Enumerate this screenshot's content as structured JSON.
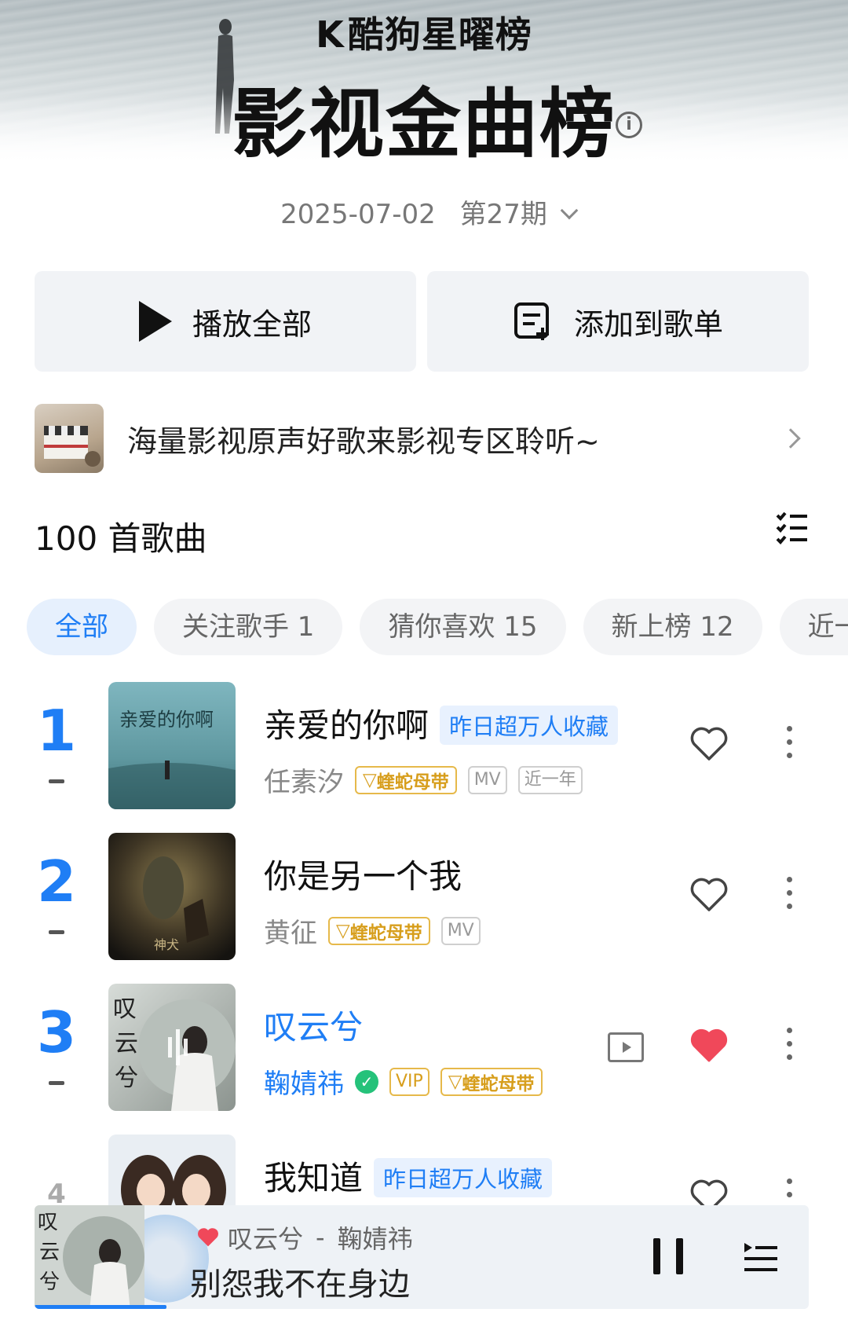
{
  "header": {
    "brand": "酷狗星曜榜",
    "title": "影视金曲榜",
    "date": "2025-07-02",
    "issue": "第27期"
  },
  "actions": {
    "play_all": "播放全部",
    "add_to_playlist": "添加到歌单"
  },
  "promo": {
    "text": "海量影视原声好歌来影视专区聆听~"
  },
  "song_count": "100 首歌曲",
  "filters": [
    {
      "label": "全部",
      "active": true
    },
    {
      "label": "关注歌手 1",
      "active": false
    },
    {
      "label": "猜你喜欢 15",
      "active": false
    },
    {
      "label": "新上榜 12",
      "active": false
    },
    {
      "label": "近一年",
      "active": false
    }
  ],
  "songs": [
    {
      "rank": "1",
      "title": "亲爱的你啊",
      "tag": "昨日超万人收藏",
      "artist": "任素汐",
      "badges": [
        "蝰蛇母带",
        "MV",
        "近一年"
      ],
      "liked": false
    },
    {
      "rank": "2",
      "title": "你是另一个我",
      "tag": "",
      "artist": "黄征",
      "badges": [
        "蝰蛇母带",
        "MV"
      ],
      "liked": false
    },
    {
      "rank": "3",
      "title": "叹云兮",
      "tag": "",
      "artist": "鞠婧祎",
      "badges": [
        "VIP",
        "蝰蛇母带"
      ],
      "liked": true,
      "playing": true
    },
    {
      "rank": "4",
      "title": "我知道",
      "tag": "昨日超万人收藏",
      "artist": "",
      "badges": [],
      "liked": false
    }
  ],
  "player": {
    "song": "叹云兮",
    "separator": "-",
    "artist": "鞠婧祎",
    "lyric": "别怨我不在身边",
    "progress": 0.17
  },
  "colors": {
    "accent": "#1f7ef5",
    "heart_active": "#f0485a",
    "gold_badge": "#d79e1c"
  }
}
